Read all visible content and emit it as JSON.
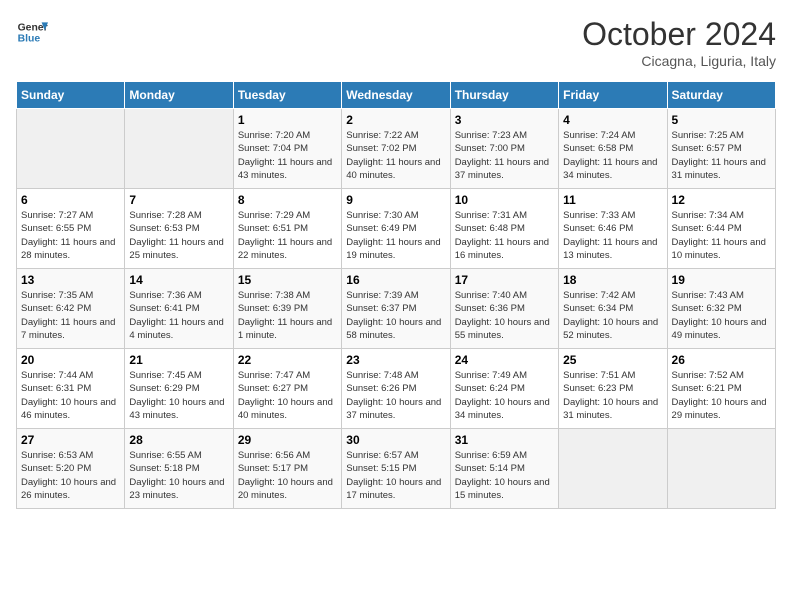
{
  "header": {
    "logo_line1": "General",
    "logo_line2": "Blue",
    "month": "October 2024",
    "location": "Cicagna, Liguria, Italy"
  },
  "weekdays": [
    "Sunday",
    "Monday",
    "Tuesday",
    "Wednesday",
    "Thursday",
    "Friday",
    "Saturday"
  ],
  "weeks": [
    [
      {
        "day": "",
        "sunrise": "",
        "sunset": "",
        "daylight": ""
      },
      {
        "day": "",
        "sunrise": "",
        "sunset": "",
        "daylight": ""
      },
      {
        "day": "1",
        "sunrise": "Sunrise: 7:20 AM",
        "sunset": "Sunset: 7:04 PM",
        "daylight": "Daylight: 11 hours and 43 minutes."
      },
      {
        "day": "2",
        "sunrise": "Sunrise: 7:22 AM",
        "sunset": "Sunset: 7:02 PM",
        "daylight": "Daylight: 11 hours and 40 minutes."
      },
      {
        "day": "3",
        "sunrise": "Sunrise: 7:23 AM",
        "sunset": "Sunset: 7:00 PM",
        "daylight": "Daylight: 11 hours and 37 minutes."
      },
      {
        "day": "4",
        "sunrise": "Sunrise: 7:24 AM",
        "sunset": "Sunset: 6:58 PM",
        "daylight": "Daylight: 11 hours and 34 minutes."
      },
      {
        "day": "5",
        "sunrise": "Sunrise: 7:25 AM",
        "sunset": "Sunset: 6:57 PM",
        "daylight": "Daylight: 11 hours and 31 minutes."
      }
    ],
    [
      {
        "day": "6",
        "sunrise": "Sunrise: 7:27 AM",
        "sunset": "Sunset: 6:55 PM",
        "daylight": "Daylight: 11 hours and 28 minutes."
      },
      {
        "day": "7",
        "sunrise": "Sunrise: 7:28 AM",
        "sunset": "Sunset: 6:53 PM",
        "daylight": "Daylight: 11 hours and 25 minutes."
      },
      {
        "day": "8",
        "sunrise": "Sunrise: 7:29 AM",
        "sunset": "Sunset: 6:51 PM",
        "daylight": "Daylight: 11 hours and 22 minutes."
      },
      {
        "day": "9",
        "sunrise": "Sunrise: 7:30 AM",
        "sunset": "Sunset: 6:49 PM",
        "daylight": "Daylight: 11 hours and 19 minutes."
      },
      {
        "day": "10",
        "sunrise": "Sunrise: 7:31 AM",
        "sunset": "Sunset: 6:48 PM",
        "daylight": "Daylight: 11 hours and 16 minutes."
      },
      {
        "day": "11",
        "sunrise": "Sunrise: 7:33 AM",
        "sunset": "Sunset: 6:46 PM",
        "daylight": "Daylight: 11 hours and 13 minutes."
      },
      {
        "day": "12",
        "sunrise": "Sunrise: 7:34 AM",
        "sunset": "Sunset: 6:44 PM",
        "daylight": "Daylight: 11 hours and 10 minutes."
      }
    ],
    [
      {
        "day": "13",
        "sunrise": "Sunrise: 7:35 AM",
        "sunset": "Sunset: 6:42 PM",
        "daylight": "Daylight: 11 hours and 7 minutes."
      },
      {
        "day": "14",
        "sunrise": "Sunrise: 7:36 AM",
        "sunset": "Sunset: 6:41 PM",
        "daylight": "Daylight: 11 hours and 4 minutes."
      },
      {
        "day": "15",
        "sunrise": "Sunrise: 7:38 AM",
        "sunset": "Sunset: 6:39 PM",
        "daylight": "Daylight: 11 hours and 1 minute."
      },
      {
        "day": "16",
        "sunrise": "Sunrise: 7:39 AM",
        "sunset": "Sunset: 6:37 PM",
        "daylight": "Daylight: 10 hours and 58 minutes."
      },
      {
        "day": "17",
        "sunrise": "Sunrise: 7:40 AM",
        "sunset": "Sunset: 6:36 PM",
        "daylight": "Daylight: 10 hours and 55 minutes."
      },
      {
        "day": "18",
        "sunrise": "Sunrise: 7:42 AM",
        "sunset": "Sunset: 6:34 PM",
        "daylight": "Daylight: 10 hours and 52 minutes."
      },
      {
        "day": "19",
        "sunrise": "Sunrise: 7:43 AM",
        "sunset": "Sunset: 6:32 PM",
        "daylight": "Daylight: 10 hours and 49 minutes."
      }
    ],
    [
      {
        "day": "20",
        "sunrise": "Sunrise: 7:44 AM",
        "sunset": "Sunset: 6:31 PM",
        "daylight": "Daylight: 10 hours and 46 minutes."
      },
      {
        "day": "21",
        "sunrise": "Sunrise: 7:45 AM",
        "sunset": "Sunset: 6:29 PM",
        "daylight": "Daylight: 10 hours and 43 minutes."
      },
      {
        "day": "22",
        "sunrise": "Sunrise: 7:47 AM",
        "sunset": "Sunset: 6:27 PM",
        "daylight": "Daylight: 10 hours and 40 minutes."
      },
      {
        "day": "23",
        "sunrise": "Sunrise: 7:48 AM",
        "sunset": "Sunset: 6:26 PM",
        "daylight": "Daylight: 10 hours and 37 minutes."
      },
      {
        "day": "24",
        "sunrise": "Sunrise: 7:49 AM",
        "sunset": "Sunset: 6:24 PM",
        "daylight": "Daylight: 10 hours and 34 minutes."
      },
      {
        "day": "25",
        "sunrise": "Sunrise: 7:51 AM",
        "sunset": "Sunset: 6:23 PM",
        "daylight": "Daylight: 10 hours and 31 minutes."
      },
      {
        "day": "26",
        "sunrise": "Sunrise: 7:52 AM",
        "sunset": "Sunset: 6:21 PM",
        "daylight": "Daylight: 10 hours and 29 minutes."
      }
    ],
    [
      {
        "day": "27",
        "sunrise": "Sunrise: 6:53 AM",
        "sunset": "Sunset: 5:20 PM",
        "daylight": "Daylight: 10 hours and 26 minutes."
      },
      {
        "day": "28",
        "sunrise": "Sunrise: 6:55 AM",
        "sunset": "Sunset: 5:18 PM",
        "daylight": "Daylight: 10 hours and 23 minutes."
      },
      {
        "day": "29",
        "sunrise": "Sunrise: 6:56 AM",
        "sunset": "Sunset: 5:17 PM",
        "daylight": "Daylight: 10 hours and 20 minutes."
      },
      {
        "day": "30",
        "sunrise": "Sunrise: 6:57 AM",
        "sunset": "Sunset: 5:15 PM",
        "daylight": "Daylight: 10 hours and 17 minutes."
      },
      {
        "day": "31",
        "sunrise": "Sunrise: 6:59 AM",
        "sunset": "Sunset: 5:14 PM",
        "daylight": "Daylight: 10 hours and 15 minutes."
      },
      {
        "day": "",
        "sunrise": "",
        "sunset": "",
        "daylight": ""
      },
      {
        "day": "",
        "sunrise": "",
        "sunset": "",
        "daylight": ""
      }
    ]
  ]
}
